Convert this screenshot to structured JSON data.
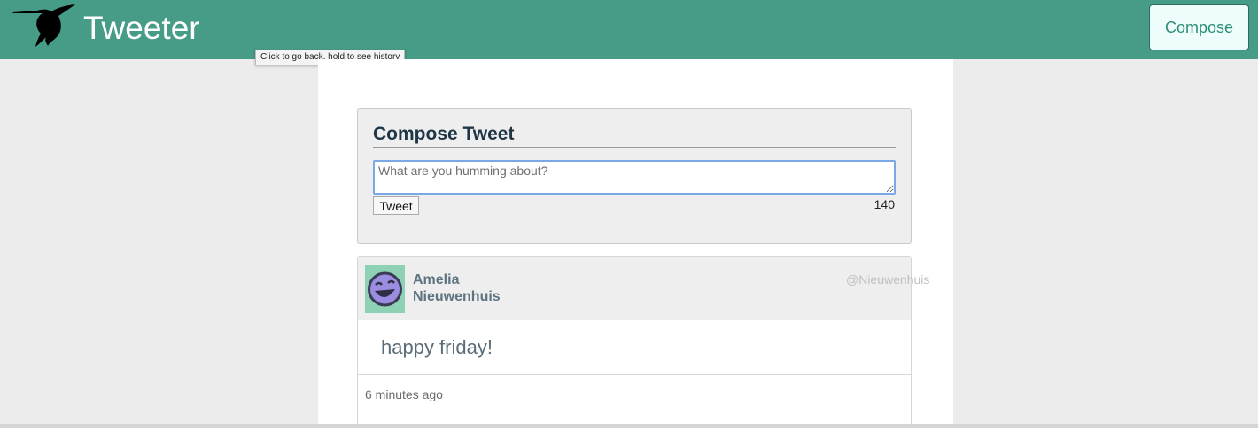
{
  "navbar": {
    "brand": "Tweeter",
    "compose_label": "Compose",
    "logo_icon": "hummingbird-icon",
    "background_color": "#479c88"
  },
  "tooltip": {
    "text": "Click to go back, hold to see history"
  },
  "compose": {
    "title": "Compose Tweet",
    "placeholder": "What are you humming about?",
    "value": "",
    "button_label": "Tweet",
    "char_counter": "140"
  },
  "tweets": [
    {
      "author": "Amelia Nieuwenhuis",
      "handle": "@Nieuwenhuis",
      "avatar_icon": "laughing-face-avatar-icon",
      "body": "happy friday!",
      "timestamp": "6 minutes ago"
    }
  ]
}
